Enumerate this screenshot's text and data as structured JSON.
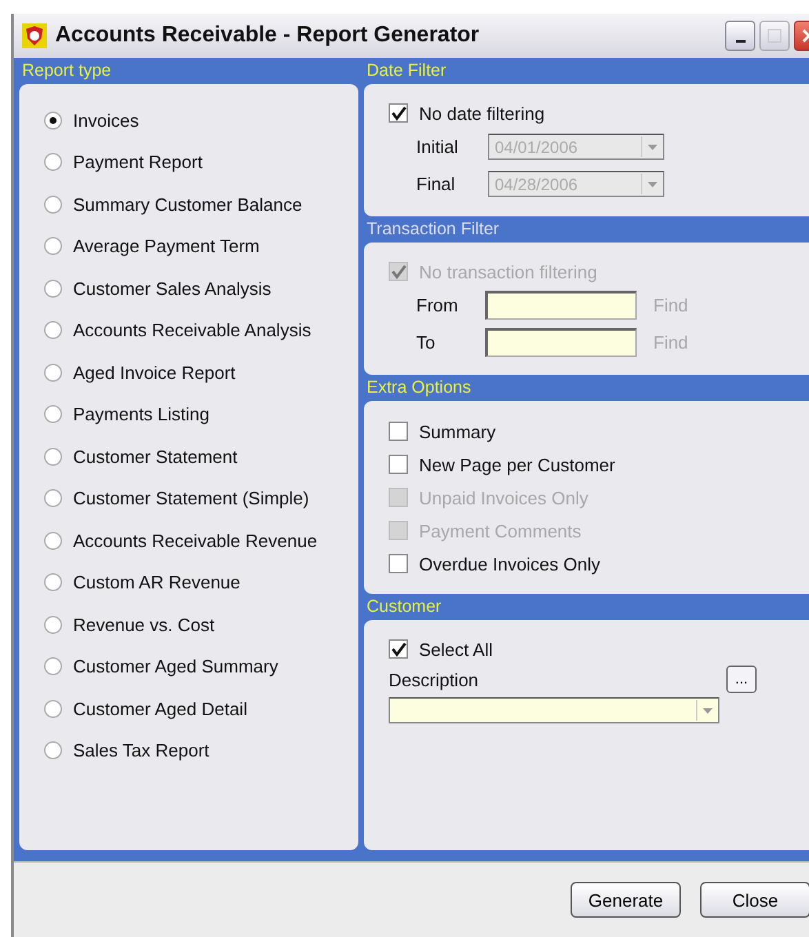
{
  "window": {
    "title": "Accounts Receivable - Report Generator"
  },
  "report_type": {
    "title": "Report type",
    "options": [
      {
        "label": "Invoices",
        "selected": true
      },
      {
        "label": "Payment Report",
        "selected": false
      },
      {
        "label": "Summary Customer Balance",
        "selected": false
      },
      {
        "label": "Average Payment Term",
        "selected": false
      },
      {
        "label": "Customer Sales Analysis",
        "selected": false
      },
      {
        "label": "Accounts Receivable Analysis",
        "selected": false
      },
      {
        "label": "Aged Invoice Report",
        "selected": false
      },
      {
        "label": "Payments Listing",
        "selected": false
      },
      {
        "label": "Customer Statement",
        "selected": false
      },
      {
        "label": "Customer Statement (Simple)",
        "selected": false
      },
      {
        "label": "Accounts Receivable Revenue",
        "selected": false
      },
      {
        "label": "Custom AR Revenue",
        "selected": false
      },
      {
        "label": "Revenue vs. Cost",
        "selected": false
      },
      {
        "label": "Customer Aged Summary",
        "selected": false
      },
      {
        "label": "Customer Aged Detail",
        "selected": false
      },
      {
        "label": "Sales Tax Report",
        "selected": false
      }
    ]
  },
  "date_filter": {
    "title": "Date Filter",
    "no_date": {
      "label": "No date filtering",
      "checked": true,
      "disabled": false
    },
    "fields": [
      {
        "label": "Initial",
        "value": "04/01/2006",
        "disabled": true
      },
      {
        "label": "Final",
        "value": "04/28/2006",
        "disabled": true
      }
    ]
  },
  "transaction_filter": {
    "title": "Transaction Filter",
    "no_filter": {
      "label": "No transaction filtering",
      "checked": true,
      "disabled": true
    },
    "fields": [
      {
        "label": "From",
        "link": "Find"
      },
      {
        "label": "To",
        "link": "Find"
      }
    ]
  },
  "extra_options": {
    "title": "Extra Options",
    "options": [
      {
        "label": "Summary",
        "checked": false,
        "disabled": false
      },
      {
        "label": "New Page per Customer",
        "checked": false,
        "disabled": false
      },
      {
        "label": "Unpaid Invoices Only",
        "checked": false,
        "disabled": true
      },
      {
        "label": "Payment Comments",
        "checked": false,
        "disabled": true
      },
      {
        "label": "Overdue Invoices Only",
        "checked": false,
        "disabled": false
      }
    ]
  },
  "customer": {
    "title": "Customer",
    "select_all": {
      "label": "Select All",
      "checked": true,
      "disabled": false
    },
    "description_label": "Description",
    "browse_button": "..."
  },
  "buttons": [
    "Generate",
    "Close"
  ]
}
